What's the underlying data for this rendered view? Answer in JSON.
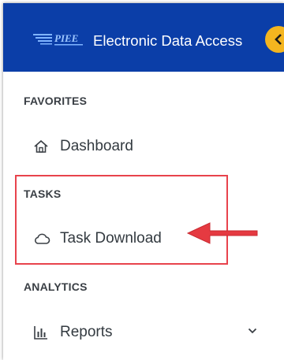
{
  "header": {
    "logo_text": "PIEE",
    "app_title": "Electronic Data Access"
  },
  "sidebar": {
    "sections": [
      {
        "title": "FAVORITES",
        "items": [
          {
            "label": "Dashboard",
            "icon": "home-icon"
          }
        ]
      },
      {
        "title": "TASKS",
        "items": [
          {
            "label": "Task Download",
            "icon": "cloud-icon"
          }
        ]
      },
      {
        "title": "ANALYTICS",
        "items": [
          {
            "label": "Reports",
            "icon": "bar-chart-icon",
            "expandable": true
          }
        ]
      }
    ]
  },
  "colors": {
    "header_bg": "#0b3ea8",
    "toggle_bg": "#f4b51f",
    "annotation": "#e8434c"
  }
}
